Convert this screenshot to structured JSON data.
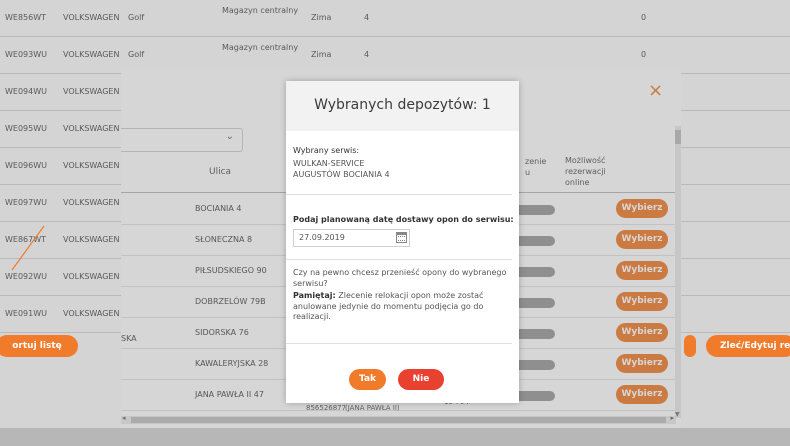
{
  "background_rows": [
    {
      "plate": "WE856WT",
      "make": "VOLKSWAGEN",
      "model": "Golf",
      "magazyn": "Magazyn centralny",
      "season": "Zima",
      "qty": "4",
      "zero": "0"
    },
    {
      "plate": "WE093WU",
      "make": "VOLKSWAGEN",
      "model": "Golf",
      "magazyn": "Magazyn centralny",
      "season": "Zima",
      "qty": "4",
      "zero": "0"
    },
    {
      "plate": "WE094WU",
      "make": "VOLKSWAGEN"
    },
    {
      "plate": "WE095WU",
      "make": "VOLKSWAGEN"
    },
    {
      "plate": "WE096WU",
      "make": "VOLKSWAGEN"
    },
    {
      "plate": "WE097WU",
      "make": "VOLKSWAGEN"
    },
    {
      "plate": "WE867WT",
      "make": "VOLKSWAGEN"
    },
    {
      "plate": "WE092WU",
      "make": "VOLKSWAGEN"
    },
    {
      "plate": "WE091WU",
      "make": "VOLKSWAGEN"
    }
  ],
  "panel": {
    "close_glyph": "×",
    "select_chevron": "⌄",
    "headers": {
      "ulica": "Ulica",
      "dostepnosc": "zenie\nu",
      "mozliwosc": "Możliwość\nrezerwacji\nonline"
    },
    "rows": [
      {
        "street": "BOCIANIA 4",
        "pick": "Wybierz"
      },
      {
        "street": "SŁONECZNA 8",
        "pick": "Wybierz"
      },
      {
        "street": "PIŁSUDSKIEGO 90",
        "pick": "Wybierz"
      },
      {
        "street": "DOBRZELÓW 79B",
        "pick": "Wybierz"
      },
      {
        "street": "SIDORSKA 76",
        "pick": "Wybierz"
      },
      {
        "street": "KAWALERYJSKA 28",
        "pick": "Wybierz"
      },
      {
        "street": "JANA PAWŁA II 47",
        "pick": "Wybierz"
      }
    ],
    "ska_fragment": "SKA",
    "extra_phone": "856526877",
    "extra_street": "(JANA PAWŁA II)",
    "extra_zip": "15-704"
  },
  "left_button": "ortuj listę",
  "right_button": "Zleć/Edytuj re",
  "modal": {
    "title": "Wybranych depozytów: 1",
    "servis_label": "Wybrany serwis:",
    "servis_name": "WULKAN-SERVICE",
    "servis_address": "AUGUSTÓW BOCIANIA 4",
    "date_label": "Podaj planowaną datę dostawy opon do serwisu:",
    "date_value": "27.09.2019",
    "question": "Czy na pewno chcesz przenieść opony do wybranego serwisu?",
    "note_bold": "Pamiętaj:",
    "note_text": " Zlecenie relokacji opon może zostać anulowane jedynie do momentu podjęcia go do realizacji.",
    "btn_yes": "Tak",
    "btn_no": "Nie"
  },
  "colors": {
    "accent": "#f07b2b",
    "danger": "#e8412f"
  }
}
